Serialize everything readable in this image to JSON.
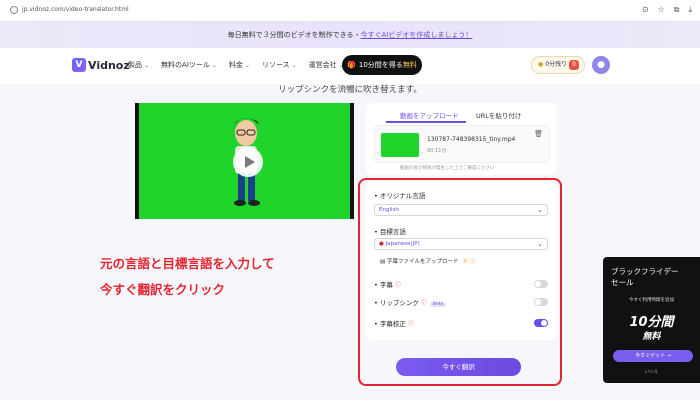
{
  "browser": {
    "url": "jp.vidnoz.com/video-translator.html",
    "icons": [
      "cast-icon",
      "star-icon",
      "extensions-icon",
      "downloads-icon"
    ]
  },
  "promo": {
    "text": "毎日無料で３分間のビデオを制作できる・",
    "link": "今すぐAIビデオを作成しましょう！"
  },
  "nav": {
    "logo": "Vidnoz",
    "items": [
      "製品",
      "無料のAIツール",
      "料金",
      "リソース",
      "運営会社"
    ],
    "cta_prefix": "10分間を得る",
    "cta_free": "無料",
    "credits": "0分残り",
    "credits_badge": "0"
  },
  "subtitle": "リップシンクを流暢に吹き替えます。",
  "upload": {
    "tab_upload": "動画をアップロード",
    "tab_url": "URLを貼り付け",
    "file_name": "130787-748398315_tiny.mp4",
    "file_duration": "00:11分",
    "note": "動画の長さ制限が発生した上でご確認ください"
  },
  "settings": {
    "source_label": "オリジナル言語",
    "source_value": "English",
    "target_label": "目標言語",
    "target_value": "Japanese(JP)",
    "subtitle_upload": "字幕ファイルをアップロード",
    "subtitles": "字幕",
    "lipsync": "リップシンク",
    "lipsync_badge": "Beta",
    "proofread": "字幕校正",
    "toggles": {
      "subtitles": false,
      "lipsync": false,
      "proofread": true
    }
  },
  "translate_button": "今すぐ翻訳",
  "annotation": {
    "line1": "元の言語と目標言語を入力して",
    "line2": "今すぐ翻訳をクリック"
  },
  "ad": {
    "title_line1": "ブラックフライデー",
    "title_line2": "セール",
    "sub": "今すぐ利用時間を追加",
    "big": "10分間",
    "free": "無料",
    "button": "今すぐゲット →",
    "foot": "いいえ"
  },
  "colors": {
    "accent": "#6b4ce6",
    "annotation": "#e0252f",
    "green_screen": "#1fd52c"
  }
}
